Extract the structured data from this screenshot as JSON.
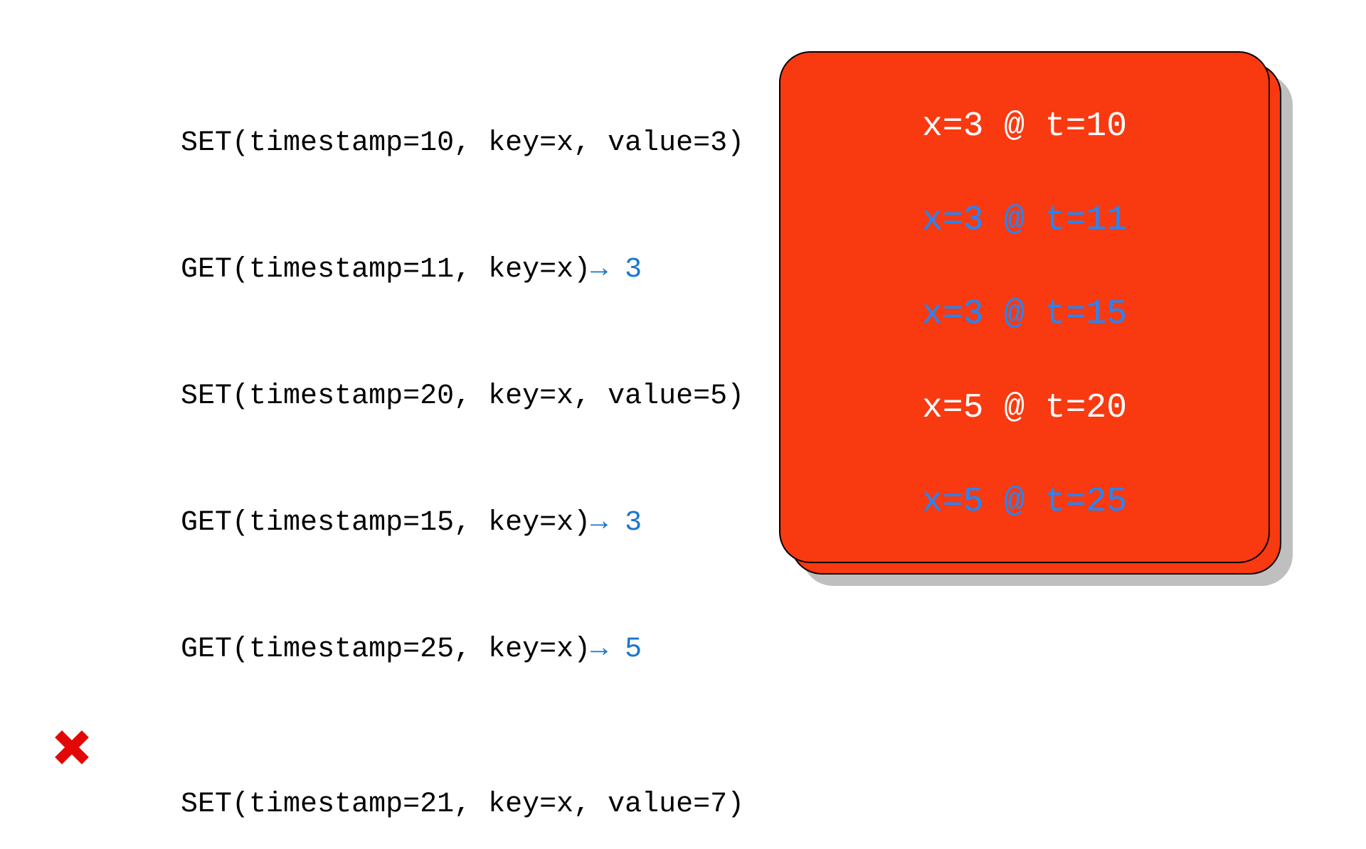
{
  "code": {
    "lines": [
      {
        "text": "SET(timestamp=10, key=x, value=3)",
        "result": null,
        "invalid": false
      },
      {
        "text": "GET(timestamp=11, key=x)",
        "result": "3",
        "invalid": false
      },
      {
        "text": "SET(timestamp=20, key=x, value=5)",
        "result": null,
        "invalid": false
      },
      {
        "text": "GET(timestamp=15, key=x)",
        "result": "3",
        "invalid": false
      },
      {
        "text": "GET(timestamp=25, key=x)",
        "result": "5",
        "invalid": false
      },
      {
        "text": "SET(timestamp=21, key=x, value=7)",
        "result": null,
        "invalid": true
      }
    ],
    "result_arrow": "→"
  },
  "state": {
    "entries": [
      {
        "text": "x=3 @ t=10",
        "color": "white"
      },
      {
        "text": "x=3 @ t=11",
        "color": "blue"
      },
      {
        "text": "x=3 @ t=15",
        "color": "blue"
      },
      {
        "text": "x=5 @ t=20",
        "color": "white"
      },
      {
        "text": "x=5 @ t=25",
        "color": "blue"
      }
    ]
  },
  "colors": {
    "accent_blue": "#1976d2",
    "card_bg": "#f93910",
    "error_red": "#e30808"
  }
}
